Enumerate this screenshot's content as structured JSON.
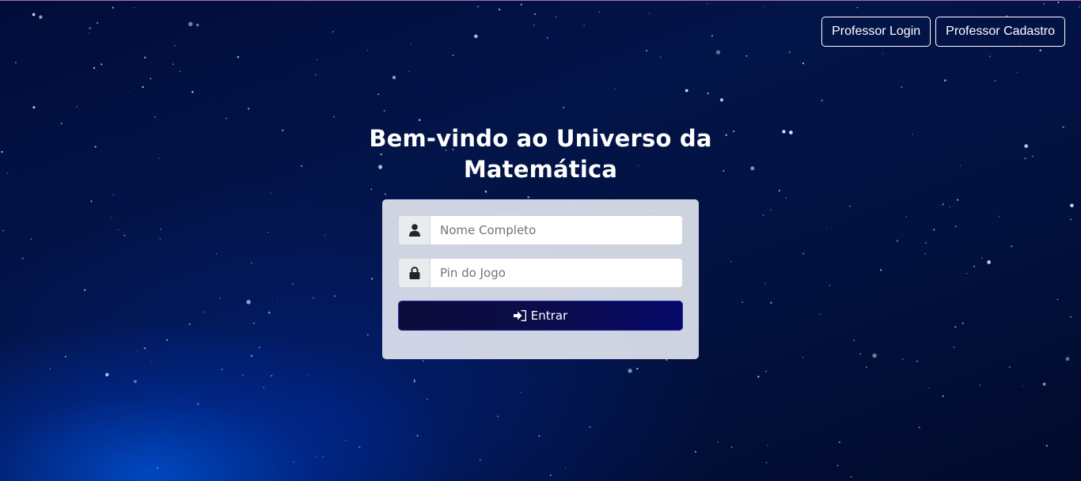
{
  "nav": {
    "professor_login": "Professor Login",
    "professor_cadastro": "Professor Cadastro"
  },
  "page": {
    "title_line1": "Bem-vindo ao Universo da",
    "title_line2": "Matemática"
  },
  "form": {
    "name": {
      "placeholder": "Nome Completo",
      "value": "",
      "icon": "user-icon"
    },
    "pin": {
      "placeholder": "Pin do Jogo",
      "value": "",
      "icon": "lock-icon"
    },
    "submit": {
      "label": "Entrar",
      "icon": "sign-in-icon"
    }
  },
  "colors": {
    "background": "#031449",
    "card": "#e4e9f2",
    "button": "#0c0c4a",
    "button_border": "#2433a8"
  }
}
